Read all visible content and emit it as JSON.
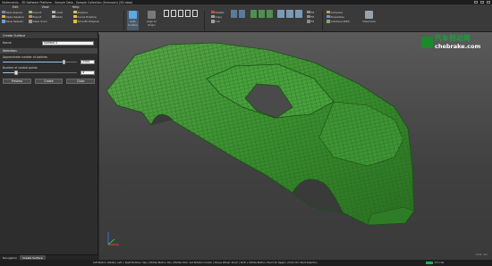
{
  "window": {
    "title": "Visilemetrix - 3D Software Platform - Sample Data - Sample Collection (Unknown) (3D data)"
  },
  "menus": [
    "Edit",
    "View",
    "Help"
  ],
  "ribbon": {
    "view_group": [
      "New Session",
      "Open Session",
      "Save Session"
    ],
    "file_group": [
      "Import",
      "Export",
      "Clear Scan"
    ],
    "undo_group": [
      "Undo",
      "Redo"
    ],
    "entity_group": [
      "Polyline",
      "Curve Polyline",
      "Smooth Polyline",
      "Add Feature"
    ],
    "entity_label": "Add Entity",
    "auto_surface": "Auto Surface",
    "align_origin": "Align to Origin",
    "select_label": "Select",
    "edit_group": [
      "Delete",
      "Copy",
      "Cut"
    ],
    "clean_label": "Clean",
    "patches_label": "Patches",
    "surface_group": [
      "Fit",
      "Fit",
      "Fit"
    ],
    "right_group": [
      "Compare",
      "Properties",
      "Combine With"
    ],
    "viewmode_label": "Viewmode"
  },
  "panel": {
    "header": "Create Surface",
    "name_label": "Name",
    "name_value": "Surface 2",
    "selection_label": "Selection",
    "approx_label": "Approximate number of patches",
    "approx_value": "2500",
    "approx_fraction": 0.82,
    "control_label": "Number of control points",
    "control_value": "4",
    "control_fraction": 0.18,
    "preview": "Preview",
    "create": "Create",
    "close": "Close",
    "tabs": [
      "Navigation",
      "Create Surface"
    ]
  },
  "viewport": {
    "note": "Units: mm"
  },
  "watermark": {
    "cn": "汽车制动网",
    "en": "chebrake.com"
  },
  "status": {
    "hints": "Left Button: Rotate  |  Left + Right Buttons: Spin  |  Middle Button: Pan  |  Middle Click: Set Rotation Center  |  Mouse Wheel: Zoom  |  Shift + Middle Button: Zoom On Region  |  Hold Ctrl: Start Selection",
    "progress_fraction": 1.0,
    "memory": "15.1 Gb"
  },
  "colors": {
    "mesh": "#3a8f2f",
    "mesh_line": "#1f5e19",
    "accent": "#1fb24a",
    "watermark": "#16a33d"
  }
}
